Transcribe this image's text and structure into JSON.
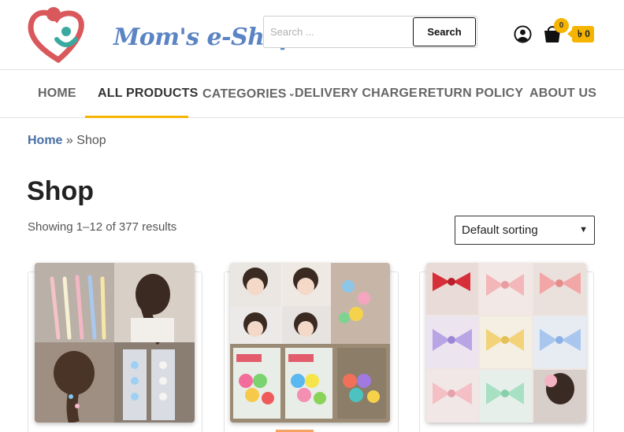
{
  "header": {
    "logo_text": "Mom's e-Shop BD",
    "search": {
      "placeholder": "Search ...",
      "value": "",
      "button_label": "Search"
    },
    "account_icon": "user-circle-icon",
    "cart": {
      "icon": "shopping-bag-icon",
      "count": "0",
      "total": "৳ 0"
    }
  },
  "nav": {
    "items": [
      {
        "label": "HOME"
      },
      {
        "label": "ALL PRODUCTS"
      },
      {
        "label": "CATEGORIES",
        "has_dropdown": true
      },
      {
        "label": "DELIVERY CHARGE"
      },
      {
        "label": "RETURN POLICY"
      },
      {
        "label": "ABOUT US"
      }
    ],
    "active": "ALL PRODUCTS"
  },
  "breadcrumb": {
    "home": "Home",
    "separator": "»",
    "current": "Shop"
  },
  "main": {
    "title": "Shop",
    "result_count": "Showing 1–12 of 377 results",
    "sort": {
      "selected": "Default sorting"
    }
  },
  "colors": {
    "accent": "#f5b400",
    "logo_blue": "#5b84c4",
    "logo_pink": "#d9585c",
    "link_blue": "#4a6fa5"
  }
}
